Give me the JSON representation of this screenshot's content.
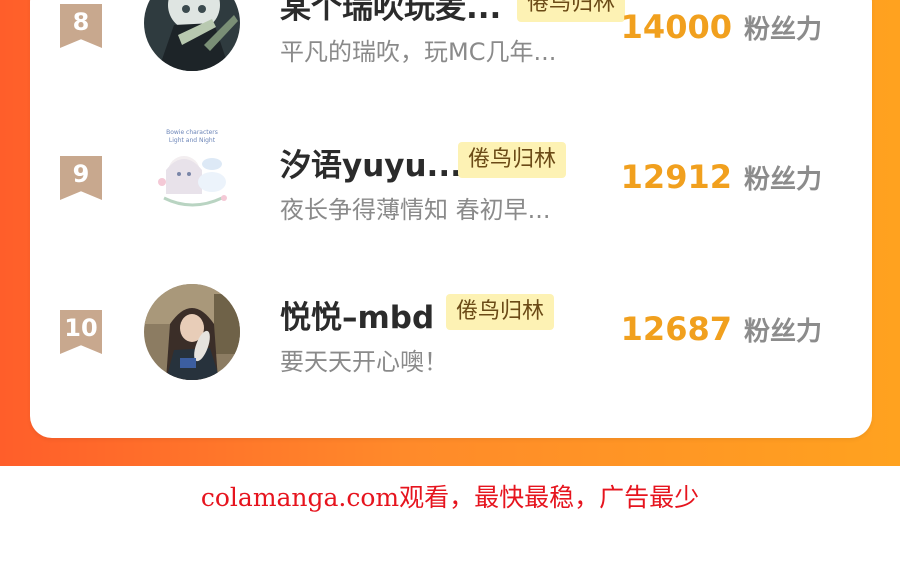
{
  "ranking": [
    {
      "rank": "8",
      "name": "某个瑞吹玩麦...",
      "tag": "倦鸟归林",
      "signature": "平凡的瑞吹，玩MC几年...",
      "fans": "14000",
      "fans_unit": "粉丝力"
    },
    {
      "rank": "9",
      "name": "汐语yuyu...",
      "tag": "倦鸟归林",
      "signature": "夜长争得薄情知 春初早...",
      "fans": "12912",
      "fans_unit": "粉丝力"
    },
    {
      "rank": "10",
      "name": "悦悦–mbd",
      "tag": "倦鸟归林",
      "signature": "要天天开心噢！",
      "fans": "12687",
      "fans_unit": "粉丝力"
    }
  ],
  "footer": {
    "text": "colamanga.com观看，最快最稳，广告最少"
  },
  "colors": {
    "banner_start": "#ff5e2a",
    "banner_end": "#ffa21f",
    "fans_number": "#f1a01e",
    "tag_bg": "#fdf2b4",
    "footer_text": "#e6141e"
  }
}
